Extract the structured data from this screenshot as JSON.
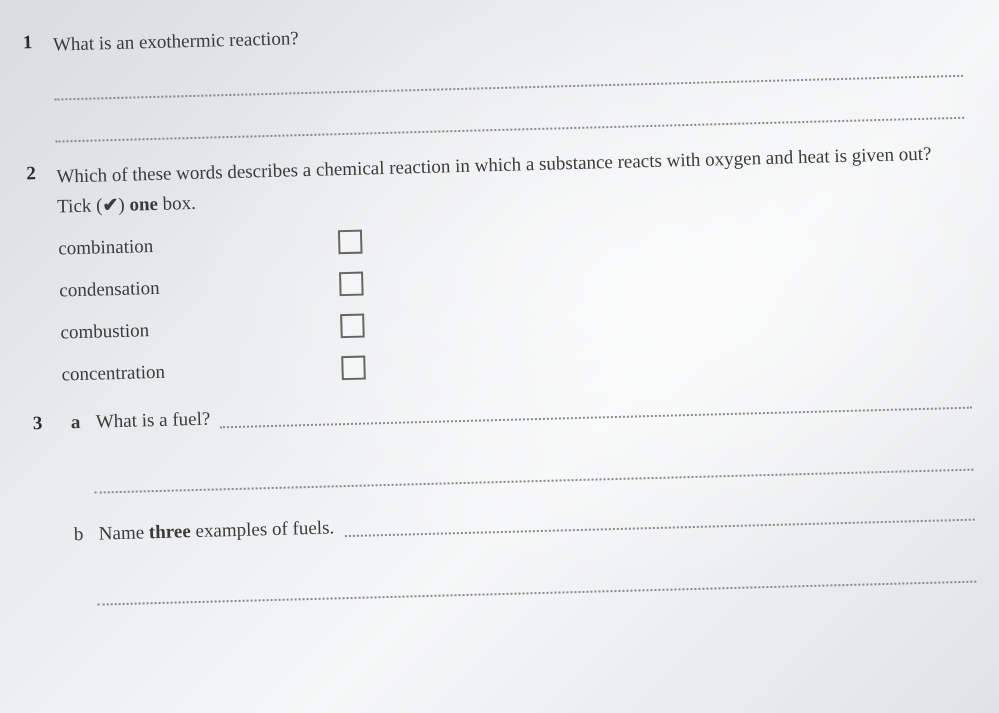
{
  "q1": {
    "number": "1",
    "text": "What is an exothermic reaction?"
  },
  "q2": {
    "number": "2",
    "text_part1": "Which of these words describes a chemical reaction in which a substance reacts with oxygen and heat is given out? Tick (",
    "tick": "✔",
    "text_part2": ") ",
    "bold_word": "one",
    "text_part3": " box.",
    "options": [
      "combination",
      "condensation",
      "combustion",
      "concentration"
    ]
  },
  "q3": {
    "number": "3",
    "a_letter": "a",
    "a_text": "What is a fuel?",
    "b_letter": "b",
    "b_text_part1": "Name ",
    "b_bold": "three",
    "b_text_part2": " examples of fuels."
  }
}
